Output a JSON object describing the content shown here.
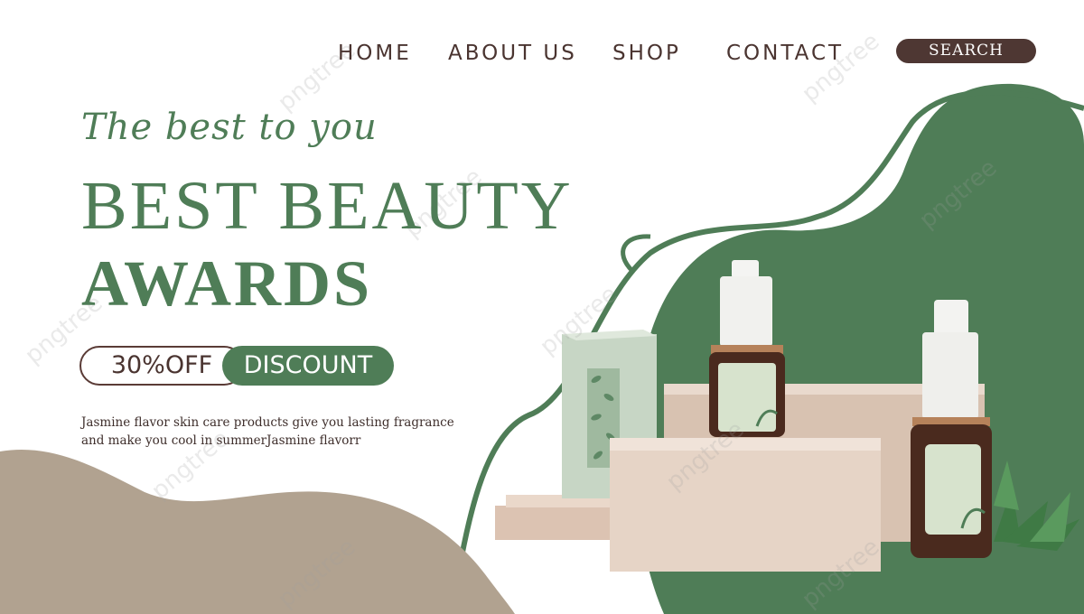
{
  "nav": {
    "home": "HOME",
    "about": "ABOUT US",
    "shop": "SHOP",
    "contact": "CONTACT",
    "search": "SEARCH"
  },
  "hero": {
    "tagline": "The best to you",
    "title_line1": "BEST BEAUTY",
    "title_line2": "AWARDS",
    "discount_percent": "30%OFF",
    "discount_label": "DISCOUNT",
    "description": "Jasmine flavor skin care products give you lasting fragrance and make you cool in summerJasmine flavorr"
  },
  "watermark": "pngtree",
  "colors": {
    "green": "#4f7d57",
    "brown": "#4e3733",
    "taupe": "#b1a290",
    "box": "#e6d4c6"
  }
}
